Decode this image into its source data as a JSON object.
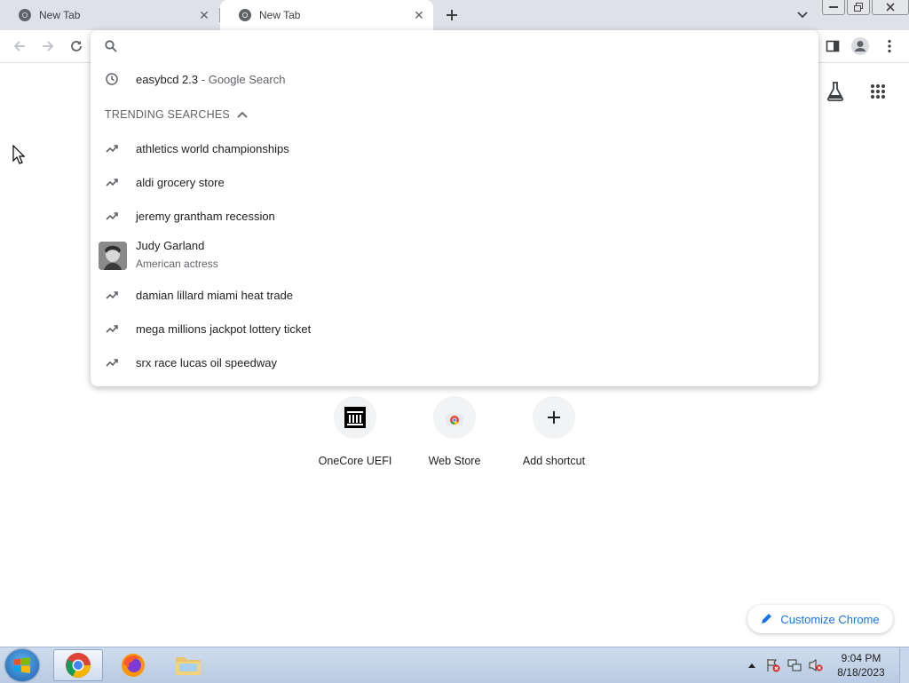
{
  "tabs": [
    {
      "title": "New Tab",
      "active": false
    },
    {
      "title": "New Tab",
      "active": true
    }
  ],
  "omnibox": {
    "value": "",
    "placeholder": ""
  },
  "history_suggestion": {
    "query": "easybcd 2.3",
    "separator": "-",
    "source": "Google Search"
  },
  "trending_header": "TRENDING SEARCHES",
  "trending": [
    "athletics world championships",
    "aldi grocery store",
    "jeremy grantham recession"
  ],
  "entity": {
    "title": "Judy Garland",
    "subtitle": "American actress"
  },
  "trending_more": [
    "damian lillard miami heat trade",
    "mega millions jackpot lottery ticket",
    "srx race lucas oil speedway"
  ],
  "shortcuts": [
    {
      "label": "OneCore UEFI",
      "icon": "bank-icon"
    },
    {
      "label": "Web Store",
      "icon": "webstore-icon"
    },
    {
      "label": "Add shortcut",
      "icon": "plus-icon"
    }
  ],
  "customize_label": "Customize Chrome",
  "taskbar": {
    "time": "9:04 PM",
    "date": "8/18/2023"
  },
  "colors": {
    "accent": "#1a73e8",
    "tabstrip": "#dee1e6"
  }
}
